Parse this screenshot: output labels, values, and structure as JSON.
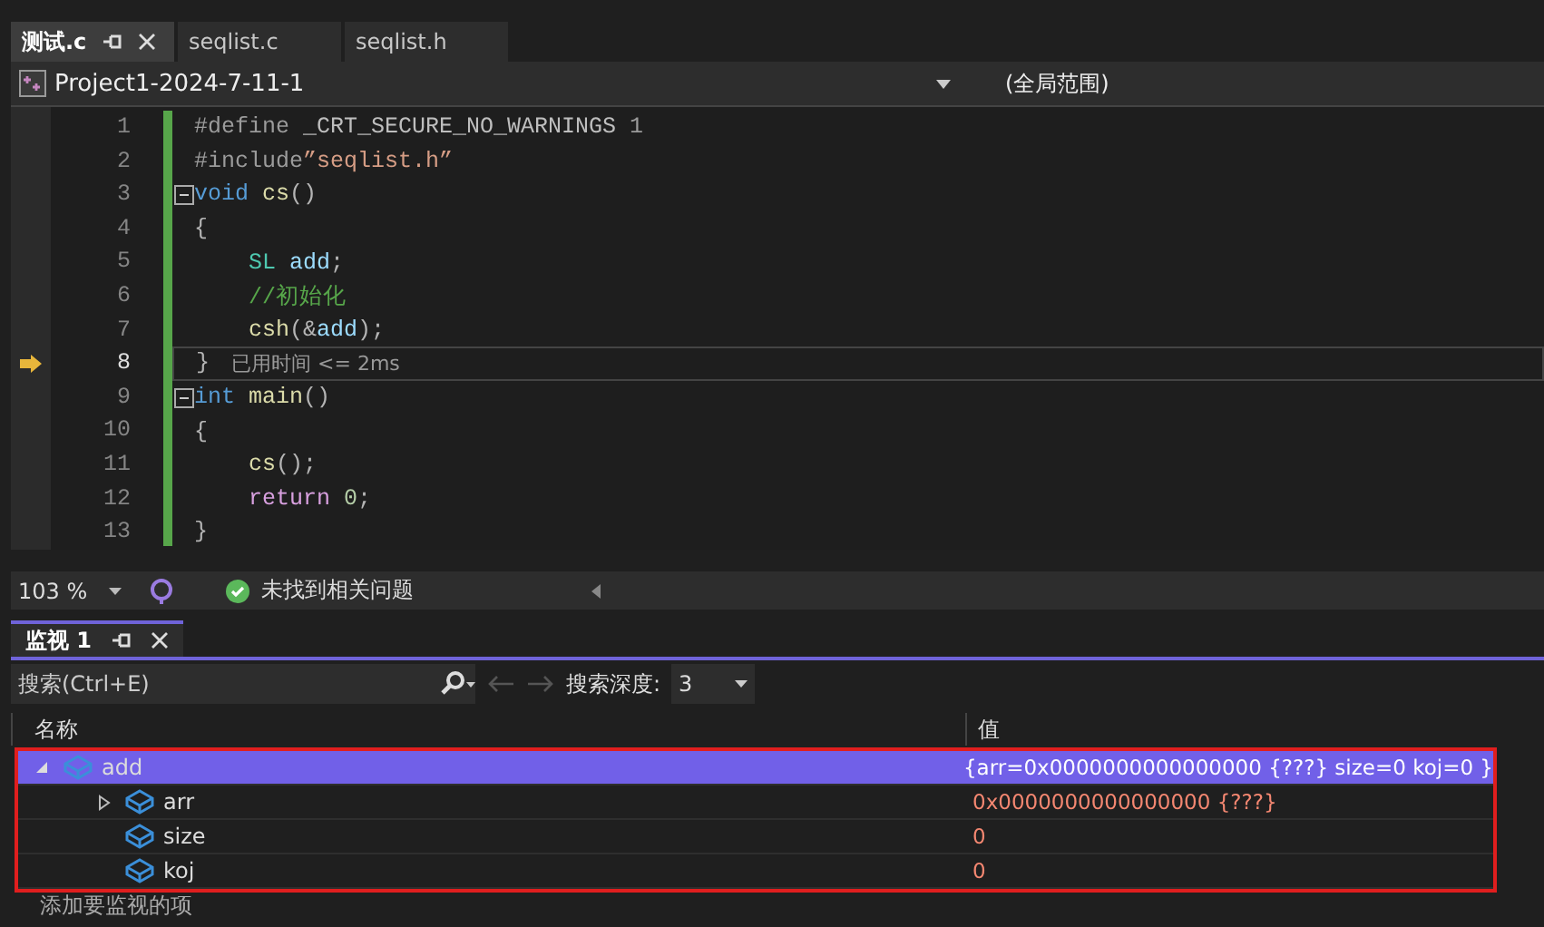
{
  "doc_tabs": [
    {
      "label": "测试.c",
      "selected": true,
      "pinned": true
    },
    {
      "label": "seqlist.c",
      "selected": false,
      "pinned": false
    },
    {
      "label": "seqlist.h",
      "selected": false,
      "pinned": false
    }
  ],
  "nav": {
    "project": "Project1-2024-7-11-1",
    "scope": "(全局范围)"
  },
  "code_lines": [
    {
      "number": "1",
      "collapsible": false,
      "current": false,
      "tokens": [
        {
          "kind": "preproc",
          "text": "#define "
        },
        {
          "kind": "macro",
          "text": "_CRT_SECURE_NO_WARNINGS "
        },
        {
          "kind": "preproc",
          "text": "1"
        }
      ]
    },
    {
      "number": "2",
      "collapsible": false,
      "current": false,
      "tokens": [
        {
          "kind": "preproc",
          "text": "#include"
        },
        {
          "kind": "string",
          "text": "”seqlist.h”"
        }
      ]
    },
    {
      "number": "3",
      "collapsible": true,
      "current": false,
      "tokens": [
        {
          "kind": "keyword",
          "text": "void "
        },
        {
          "kind": "func",
          "text": "cs"
        },
        {
          "kind": "punct",
          "text": "()"
        }
      ]
    },
    {
      "number": "4",
      "collapsible": false,
      "current": false,
      "tokens": [
        {
          "kind": "punct",
          "text": "{"
        }
      ]
    },
    {
      "number": "5",
      "collapsible": false,
      "current": false,
      "tokens": [
        {
          "kind": "type",
          "text": "    SL "
        },
        {
          "kind": "var",
          "text": "add"
        },
        {
          "kind": "punct",
          "text": ";"
        }
      ]
    },
    {
      "number": "6",
      "collapsible": false,
      "current": false,
      "tokens": [
        {
          "kind": "comment",
          "text": "    //初始化"
        }
      ]
    },
    {
      "number": "7",
      "collapsible": false,
      "current": false,
      "tokens": [
        {
          "kind": "func",
          "text": "    csh"
        },
        {
          "kind": "punct",
          "text": "(&"
        },
        {
          "kind": "var",
          "text": "add"
        },
        {
          "kind": "punct",
          "text": ");"
        }
      ]
    },
    {
      "number": "8",
      "collapsible": false,
      "current": true,
      "tokens": [
        {
          "kind": "punct",
          "text": "}"
        }
      ],
      "hint": "已用时间 <= 2ms"
    },
    {
      "number": "9",
      "collapsible": true,
      "current": false,
      "tokens": [
        {
          "kind": "keyword",
          "text": "int "
        },
        {
          "kind": "func",
          "text": "main"
        },
        {
          "kind": "punct",
          "text": "()"
        }
      ]
    },
    {
      "number": "10",
      "collapsible": false,
      "current": false,
      "tokens": [
        {
          "kind": "punct",
          "text": "{"
        }
      ]
    },
    {
      "number": "11",
      "collapsible": false,
      "current": false,
      "tokens": [
        {
          "kind": "func",
          "text": "    cs"
        },
        {
          "kind": "punct",
          "text": "();"
        }
      ]
    },
    {
      "number": "12",
      "collapsible": false,
      "current": false,
      "tokens": [
        {
          "kind": "control",
          "text": "    return "
        },
        {
          "kind": "number",
          "text": "0"
        },
        {
          "kind": "punct",
          "text": ";"
        }
      ]
    },
    {
      "number": "13",
      "collapsible": false,
      "current": false,
      "tokens": [
        {
          "kind": "punct",
          "text": "}"
        }
      ]
    }
  ],
  "editor_status": {
    "zoom": "103 %",
    "issues": "未找到相关问题"
  },
  "watch": {
    "tab": "监视 1",
    "search_placeholder": "搜索(Ctrl+E)",
    "depth_label": "搜索深度:",
    "depth": "3",
    "columns": [
      "名称",
      "值"
    ],
    "rows": [
      {
        "name": "add",
        "value": "{arr=0x0000000000000000 {???} size=0 koj=0 }",
        "selected": true,
        "expanded": true,
        "children": [
          {
            "name": "arr",
            "value": "0x0000000000000000 {???}",
            "selected": false,
            "expanded": false,
            "expandable": true,
            "changed": true
          },
          {
            "name": "size",
            "value": "0",
            "selected": false,
            "expanded": false,
            "expandable": false,
            "changed": true
          },
          {
            "name": "koj",
            "value": "0",
            "selected": false,
            "expanded": false,
            "expandable": false,
            "changed": true
          }
        ]
      }
    ],
    "add_item": "添加要监视的项"
  }
}
